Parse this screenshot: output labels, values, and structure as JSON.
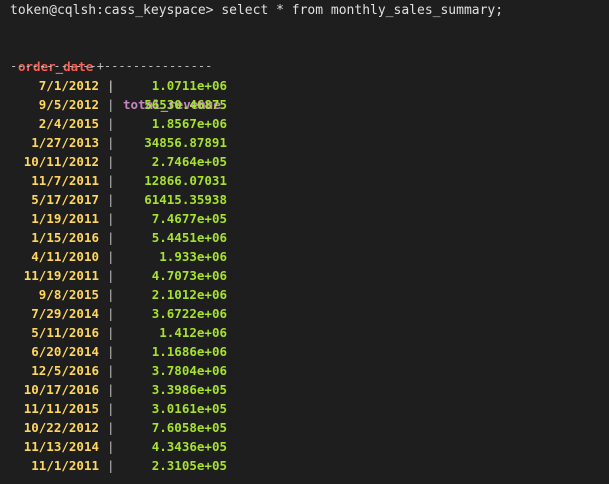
{
  "prompt": {
    "text": "token@cqlsh:cass_keyspace> select * from monthly_sales_summary;"
  },
  "table": {
    "columns": [
      "order_date",
      "total_revenue"
    ],
    "separator": "|",
    "rule": "------------+---------------",
    "rows": [
      {
        "order_date": "7/1/2012",
        "total_revenue": "1.0711e+06"
      },
      {
        "order_date": "9/5/2012",
        "total_revenue": "56530.46875"
      },
      {
        "order_date": "2/4/2015",
        "total_revenue": "1.8567e+06"
      },
      {
        "order_date": "1/27/2013",
        "total_revenue": "34856.87891"
      },
      {
        "order_date": "10/11/2012",
        "total_revenue": "2.7464e+05"
      },
      {
        "order_date": "11/7/2011",
        "total_revenue": "12866.07031"
      },
      {
        "order_date": "5/17/2017",
        "total_revenue": "61415.35938"
      },
      {
        "order_date": "1/19/2011",
        "total_revenue": "7.4677e+05"
      },
      {
        "order_date": "1/15/2016",
        "total_revenue": "5.4451e+06"
      },
      {
        "order_date": "4/11/2010",
        "total_revenue": "1.933e+06"
      },
      {
        "order_date": "11/19/2011",
        "total_revenue": "4.7073e+06"
      },
      {
        "order_date": "9/8/2015",
        "total_revenue": "2.1012e+06"
      },
      {
        "order_date": "7/29/2014",
        "total_revenue": "3.6722e+06"
      },
      {
        "order_date": "5/11/2016",
        "total_revenue": "1.412e+06"
      },
      {
        "order_date": "6/20/2014",
        "total_revenue": "1.1686e+06"
      },
      {
        "order_date": "12/5/2016",
        "total_revenue": "3.7804e+06"
      },
      {
        "order_date": "10/17/2016",
        "total_revenue": "3.3986e+05"
      },
      {
        "order_date": "11/11/2015",
        "total_revenue": "3.0161e+05"
      },
      {
        "order_date": "10/22/2012",
        "total_revenue": "7.6058e+05"
      },
      {
        "order_date": "11/13/2014",
        "total_revenue": "4.3436e+05"
      },
      {
        "order_date": "11/1/2011",
        "total_revenue": "2.3105e+05"
      }
    ]
  },
  "colors": {
    "background": "#1e1e1e",
    "header_date": "#ff5f56",
    "header_revenue": "#c586c0",
    "cell_date": "#ffd75f",
    "cell_revenue": "#a6e22e"
  }
}
